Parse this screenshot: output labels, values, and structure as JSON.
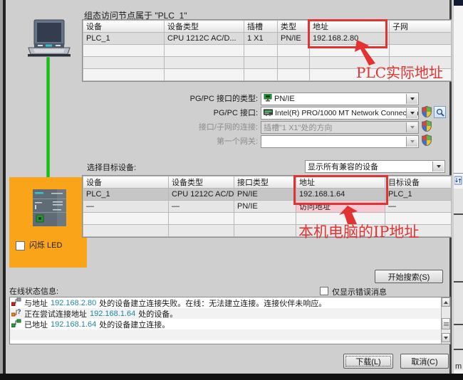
{
  "title": "组态访问节点属于 \"PLC_1\"",
  "configured_table": {
    "headers": [
      "设备",
      "设备类型",
      "插槽",
      "类型",
      "地址",
      "子网"
    ],
    "row": {
      "device": "PLC_1",
      "type": "CPU 1212C AC/D...",
      "slot": "1 X1",
      "iftype": "PN/IE",
      "address": "192.168.2.80",
      "subnet": ""
    }
  },
  "annotations": {
    "plc_address": "PLC实际地址",
    "pc_address": "本机电脑的IP地址",
    "red": "#e23333"
  },
  "pgpc": {
    "type_label": "PG/PC 接口的类型:",
    "type_value": "PN/IE",
    "interface_label": "PG/PC 接口:",
    "interface_value": "Intel(R) PRO/1000 MT Network Connection",
    "connection_label": "接口/子网的连接:",
    "connection_value": "插槽\"1 X1\"处的方向",
    "gateway_label": "第一个网关:",
    "gateway_value": ""
  },
  "target": {
    "label": "选择目标设备:",
    "filter": "显示所有兼容的设备",
    "headers": [
      "设备",
      "设备类型",
      "接口类型",
      "地址",
      "目标设备"
    ],
    "rows": [
      {
        "device": "PLC_1",
        "type": "CPU 1212C AC/D...",
        "iftype": "PN/IE",
        "address": "192.168.1.64",
        "target": "PLC_1"
      },
      {
        "device": "—",
        "type": "—",
        "iftype": "PN/IE",
        "address": "访问地址",
        "target": "—"
      }
    ]
  },
  "flash_led_label": "闪烁 LED",
  "start_search_label": "开始搜索(S)",
  "online_status_label": "在线状态信息:",
  "errors_only_label": "仅显示错误消息",
  "messages": [
    {
      "status": "failed",
      "pre": "与地址 ",
      "ip": "192.168.2.80",
      "post": " 处的设备建立连接失败。在线：无法建立连接。连接伙伴未响应。"
    },
    {
      "status": "trying",
      "pre": "正在尝试连接地址 ",
      "ip": "192.168.1.64",
      "post": " 处的设备。"
    },
    {
      "status": "connected",
      "pre": "已地址 ",
      "ip": "192.168.1.64",
      "post": " 处的设备建立连接。"
    }
  ],
  "buttons": {
    "download": "下载(L)",
    "cancel": "取消(C)"
  },
  "misc": {
    "corner_letter": "m"
  },
  "colors": {
    "accent_orange": "#faa41a",
    "link_green": "#00ce00",
    "highlight_pink": "#f7c9d2",
    "ip_teal": "#1f8a9e"
  }
}
